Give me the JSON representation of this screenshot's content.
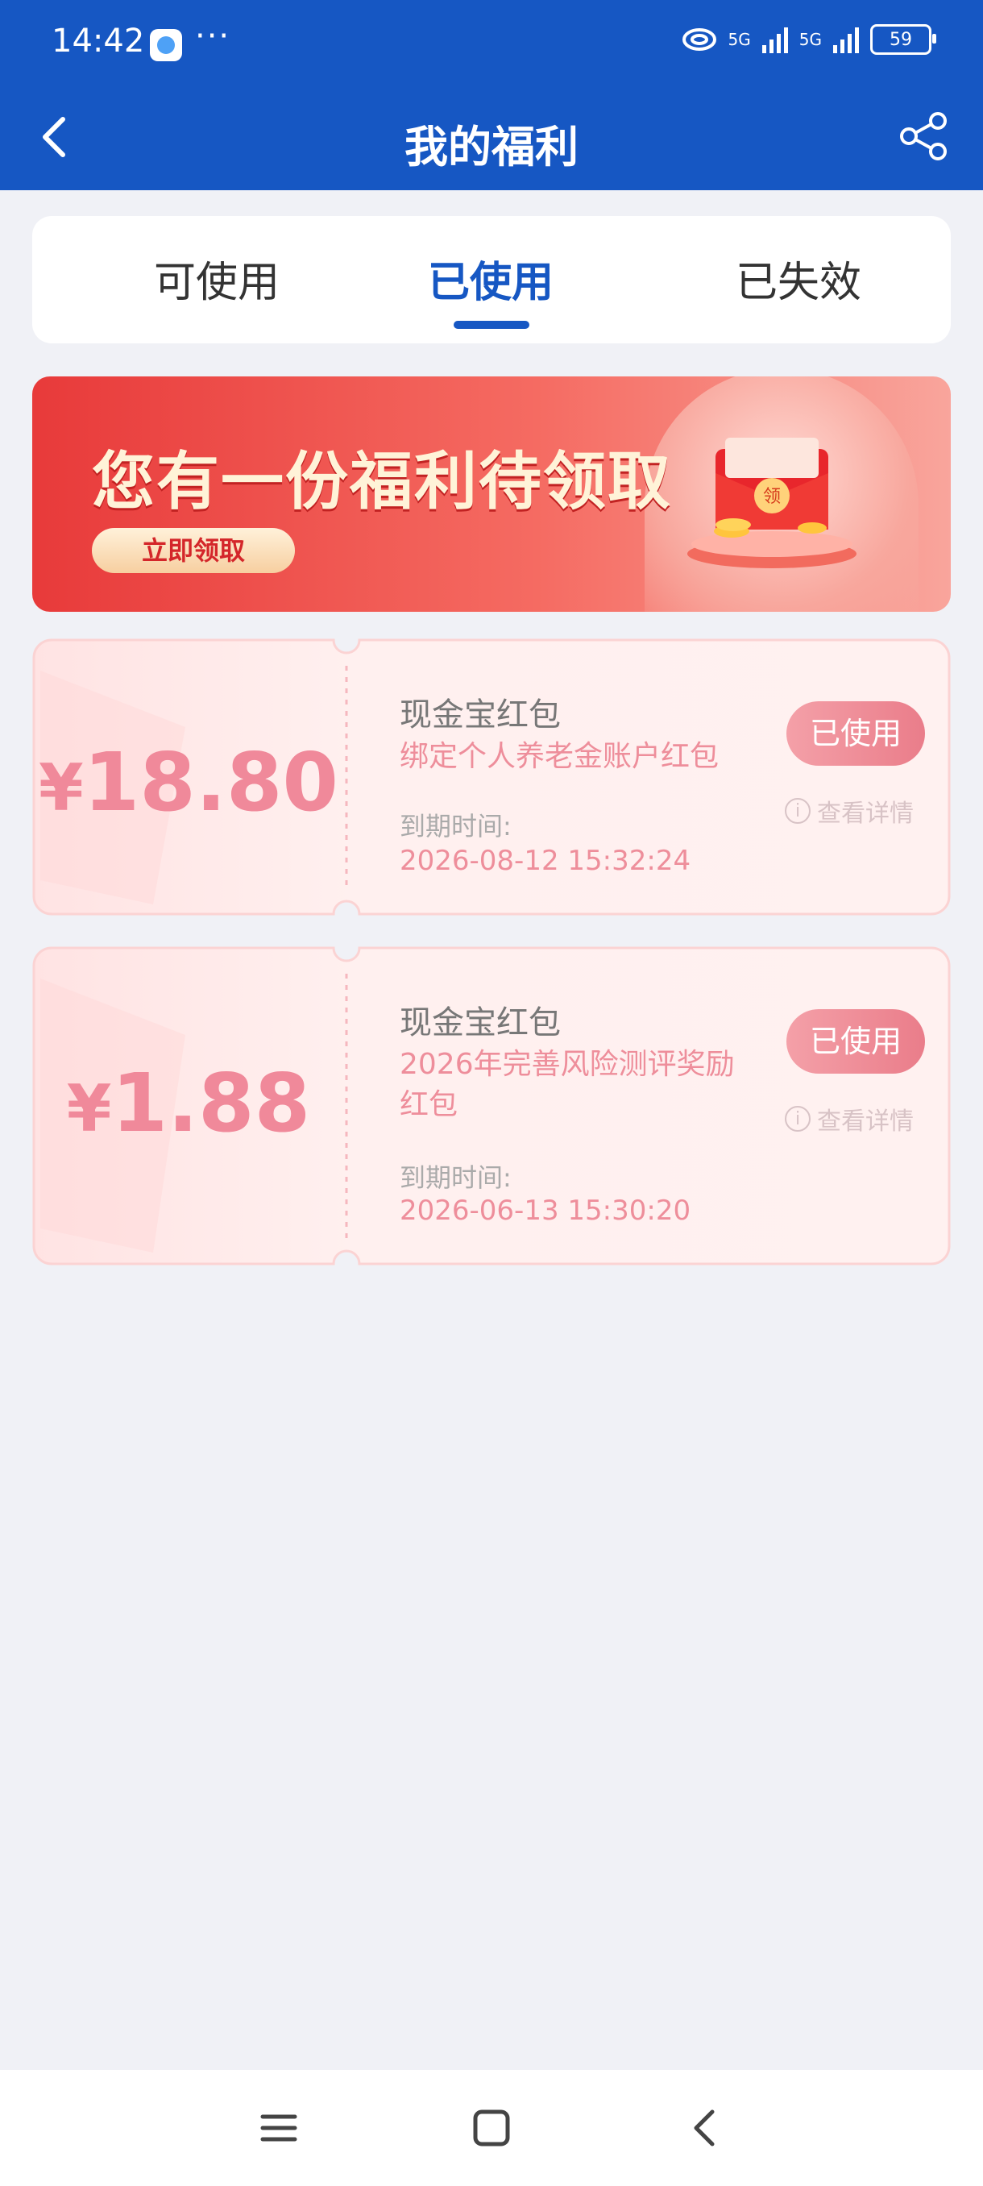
{
  "status_bar": {
    "time": "14:42",
    "more": "···",
    "network_1": "5G",
    "network_2": "5G",
    "battery": "59"
  },
  "header": {
    "title": "我的福利"
  },
  "tabs": [
    {
      "label": "可使用",
      "active": false
    },
    {
      "label": "已使用",
      "active": true
    },
    {
      "label": "已失效",
      "active": false
    }
  ],
  "banner": {
    "headline": "您有一份福利待领取",
    "cta": "立即领取",
    "envelope_label": "领"
  },
  "coupons": [
    {
      "currency": "¥",
      "amount": "18.80",
      "title": "现金宝红包",
      "description": "绑定个人养老金账户红包",
      "expiry_label": "到期时间:",
      "expiry": "2026-08-12 15:32:24",
      "status": "已使用",
      "detail": "查看详情"
    },
    {
      "currency": "¥",
      "amount": "1.88",
      "title": "现金宝红包",
      "description": "2026年完善风险测评奖励红包",
      "expiry_label": "到期时间:",
      "expiry": "2026-06-13 15:30:20",
      "status": "已使用",
      "detail": "查看详情"
    }
  ],
  "colors": {
    "primary": "#1657c3",
    "coupon_pink": "#f0899a",
    "background": "#f0f1f6"
  }
}
